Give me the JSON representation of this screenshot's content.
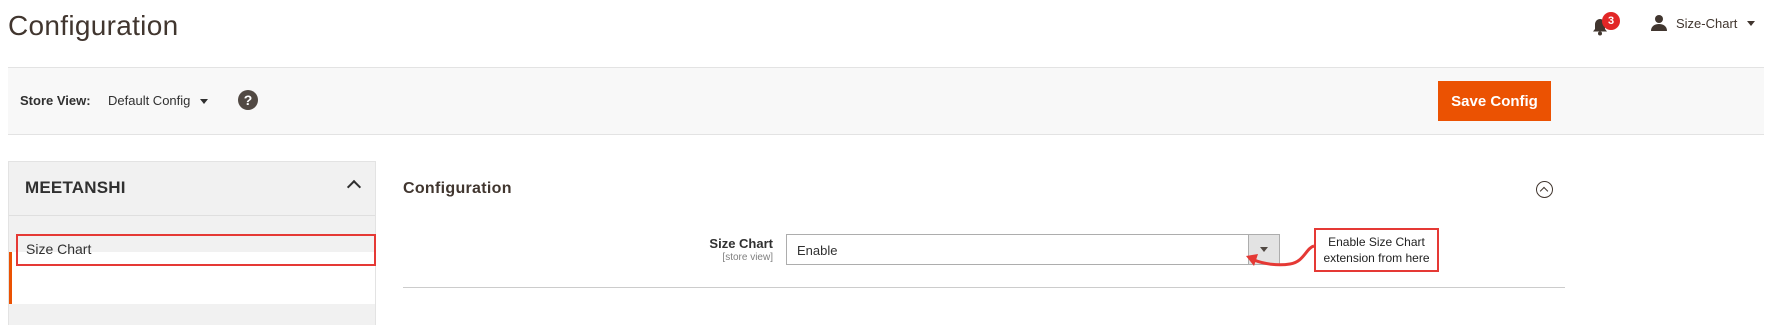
{
  "page": {
    "title": "Configuration"
  },
  "header": {
    "notifications": {
      "count": "3"
    },
    "user": {
      "name": "Size-Chart"
    }
  },
  "store_bar": {
    "label": "Store View:",
    "selected": "Default Config",
    "help": "?",
    "save_label": "Save Config"
  },
  "sidebar": {
    "brand": "MEETANSHI",
    "items": [
      {
        "label": "Size Chart",
        "active": true
      }
    ]
  },
  "section": {
    "title": "Configuration",
    "fields": [
      {
        "label": "Size Chart",
        "scope": "[store view]",
        "value": "Enable"
      }
    ]
  },
  "annotation": {
    "text_line1": "Enable Size Chart",
    "text_line2": "extension from here"
  },
  "colors": {
    "accent": "#eb5202",
    "highlight": "#e53935",
    "badge": "#e22626"
  }
}
